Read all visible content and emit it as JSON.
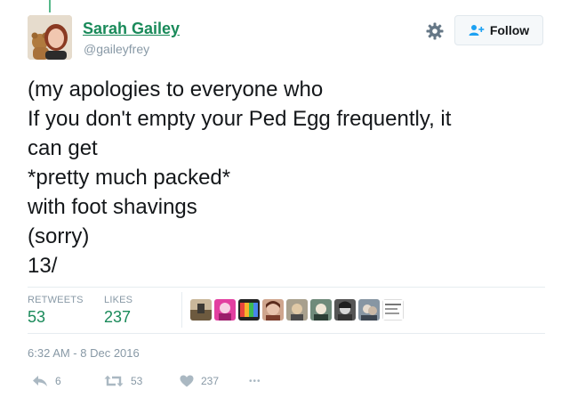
{
  "user": {
    "name": "Sarah Gailey",
    "handle": "@gaileyfrey"
  },
  "header": {
    "follow_label": "Follow"
  },
  "tweet": {
    "lines": [
      "(my apologies to everyone who",
      "If you don't empty your Ped Egg frequently, it",
      "can get",
      "*pretty much packed*",
      "with foot shavings",
      "(sorry)",
      "13/"
    ]
  },
  "stats": {
    "retweets_label": "RETWEETS",
    "retweets_value": "53",
    "likes_label": "LIKES",
    "likes_value": "237"
  },
  "timestamp": "6:32 AM - 8 Dec 2016",
  "actions": {
    "reply_count": "6",
    "retweet_count": "53",
    "like_count": "237",
    "more_glyph": "•••"
  },
  "colors": {
    "accent": "#1a8a5a",
    "muted": "#8899a6"
  }
}
